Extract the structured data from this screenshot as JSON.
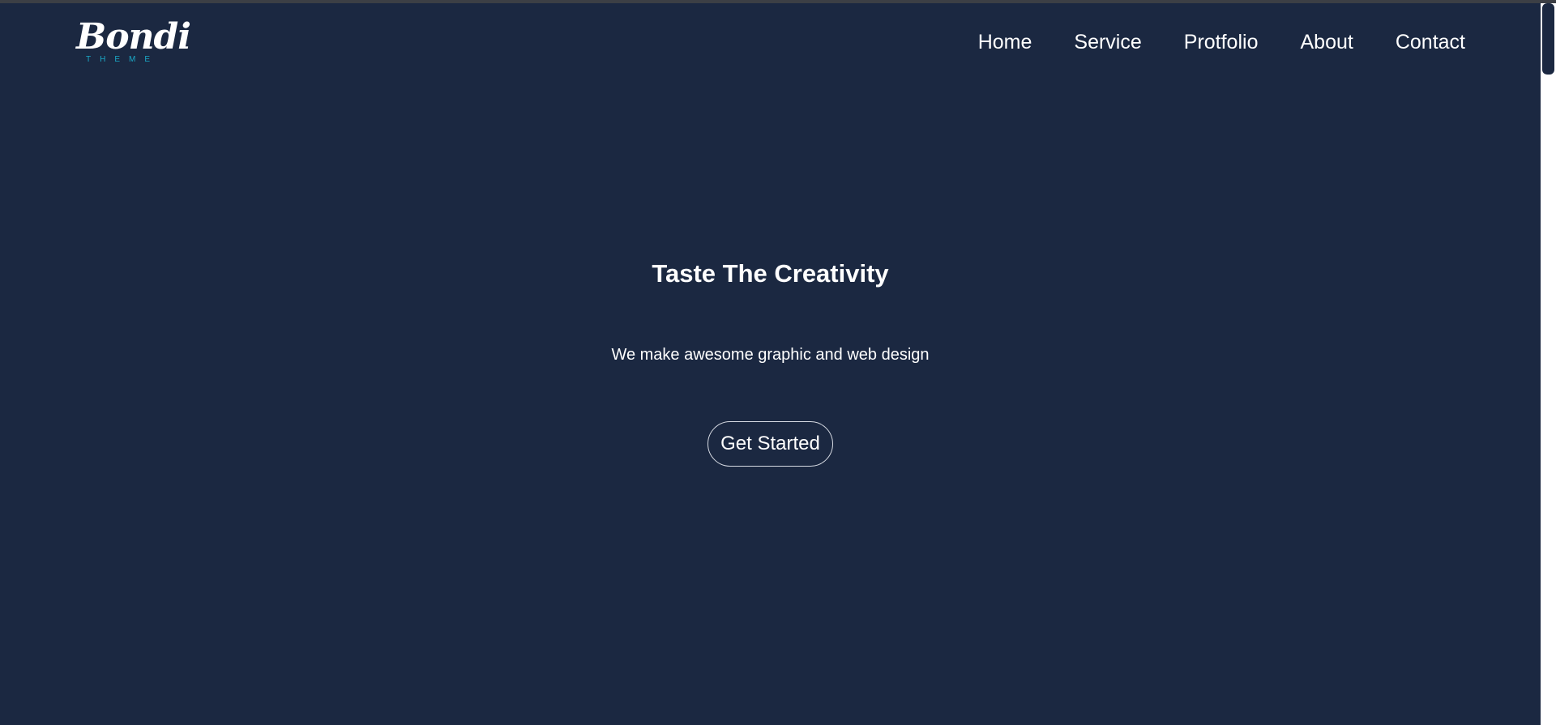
{
  "brand": {
    "name": "Bondi",
    "tagline": "THEME",
    "accent_color": "#1ba9c7"
  },
  "nav": {
    "items": [
      {
        "label": "Home"
      },
      {
        "label": "Service"
      },
      {
        "label": "Protfolio"
      },
      {
        "label": "About"
      },
      {
        "label": "Contact"
      }
    ]
  },
  "hero": {
    "title": "Taste The Creativity",
    "subtitle": "We make awesome graphic and web design",
    "cta_label": "Get Started"
  },
  "colors": {
    "background": "#1b2841",
    "text": "#ffffff",
    "button_border": "#d7dbe3"
  }
}
